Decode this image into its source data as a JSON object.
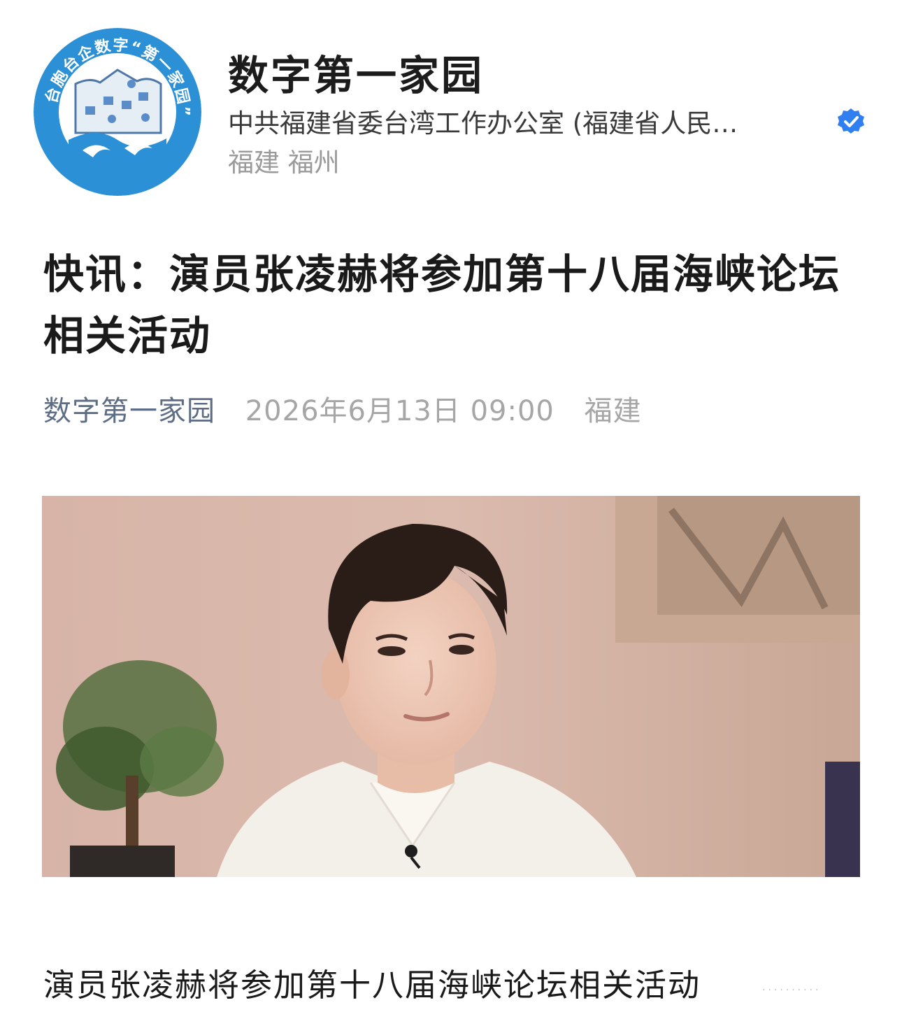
{
  "account": {
    "name": "数字第一家园",
    "organization": "中共福建省委台湾工作办公室 (福建省人民…",
    "location": "福建 福州",
    "verified": true,
    "verified_color": "#2f7ff0",
    "avatar_ring_text": "台胞台企数字“第一家园”",
    "avatar_color": "#2c90d6"
  },
  "article": {
    "title": "快讯：演员张凌赫将参加第十八届海峡论坛相关活动",
    "meta": {
      "author": "数字第一家园",
      "datetime": "2026年6月13日 09:00",
      "location": "福建"
    },
    "image_icon": "photo-icon",
    "body_first_line": "演员张凌赫将参加第十八届海峡论坛相关活动"
  },
  "colors": {
    "meta_author": "#5d6d85",
    "meta_gray": "#a6a6a6"
  }
}
